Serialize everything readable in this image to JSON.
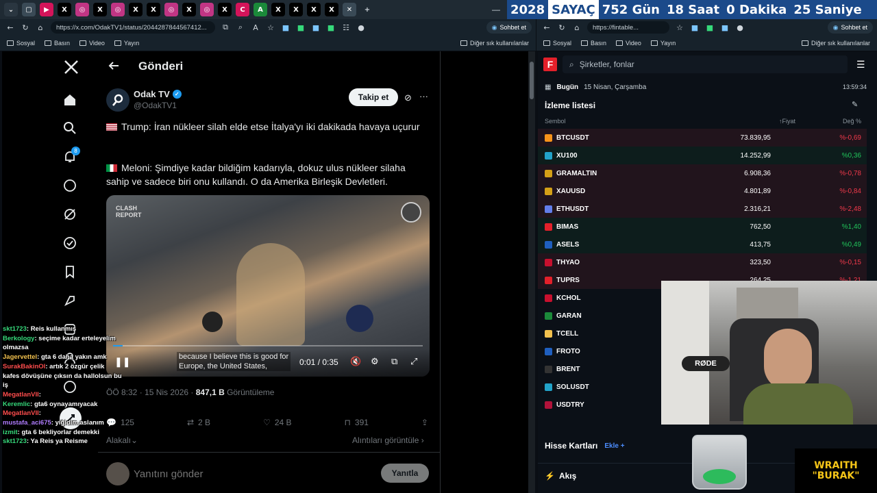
{
  "counter": {
    "year": "2028",
    "label": "SAYAÇ",
    "days": "752 Gün",
    "hours": "18 Saat",
    "minutes": "0 Dakika",
    "seconds": "25 Saniye"
  },
  "left_browser": {
    "url": "https://x.com/OdakTV1/status/2044287844567412...",
    "chat_button": "Sohbet et",
    "bookmarks": [
      "Sosyal",
      "Basın",
      "Video",
      "Yayın"
    ],
    "bookmarks_other": "Diğer sık kullanılanlar"
  },
  "x": {
    "notification_count": "8",
    "header_title": "Gönderi",
    "author_name": "Odak TV",
    "author_handle": "@OdakTV1",
    "follow_button": "Takip et",
    "paragraph1": "Trump:  İran nükleer silah elde etse İtalya'yı iki dakikada havaya uçurur",
    "paragraph2": "Meloni: Şimdiye kadar bildiğim kadarıyla, dokuz ulus nükleer silaha sahip ve sadece biri onu kullandı. O da Amerika Birleşik Devletleri.",
    "video_watermark": "CLASH REPORT",
    "video_caption_line1": "because I believe this is good for",
    "video_caption_line2": "Europe, the United States,",
    "video_time": "0:01 / 0:35",
    "video_progress": 0.03,
    "timestamp": "ÖÖ 8:32 · 15 Nis 2026 · ",
    "views_count": "847,1 B",
    "views_label": " Görüntüleme",
    "replies": "125",
    "reposts": "2 B",
    "likes": "24 B",
    "bookmarks": "391",
    "related": "Alakalı",
    "quotes_link": "Alıntıları görüntüle",
    "reply_placeholder": "Yanıtını gönder",
    "reply_button": "Yanıtla"
  },
  "chat": [
    {
      "user": "skt1723",
      "msg": "Reis kullanmış",
      "color": "#36d97b"
    },
    {
      "user": "Berkology",
      "msg": "seçime kadar erteleyelim olmazsa",
      "color": "#36d97b"
    },
    {
      "user": "Jagervettel",
      "msg": "gta 6 daha yakın amk",
      "color": "#f2c14e"
    },
    {
      "user": "SurakBakinOl",
      "msg": "artık 2 özgür çelik kafes dövüşüne çıksın da hallolsun bu iş",
      "color": "#ff4d4d"
    },
    {
      "user": "MegatlanVII",
      "msg": "",
      "color": "#ff4d4d"
    },
    {
      "user": "Keremlic",
      "msg": "gta6 oynayamıyacak",
      "color": "#36d97b"
    },
    {
      "user": "MegatlanVII",
      "msg": "",
      "color": "#ff4d4d"
    },
    {
      "user": "mustafa_aci675",
      "msg": "yiğidim aslanım",
      "color": "#b07cff"
    },
    {
      "user": "izmit",
      "msg": "gta 6 bekliyorlar demekki",
      "color": "#36d97b"
    },
    {
      "user": "skt1723",
      "msg": "Ya Reis ya Reisme",
      "color": "#36d97b"
    }
  ],
  "right_browser": {
    "url": "https://fintable...",
    "chat_button": "Sohbet et",
    "bookmarks": [
      "Sosyal",
      "Basın",
      "Video",
      "Yayın"
    ],
    "bookmarks_other": "Diğer sık kullanılanlar"
  },
  "fintable": {
    "search_placeholder": "Şirketler, fonlar",
    "today_label": "Bugün",
    "date": "15 Nisan, Çarşamba",
    "time": "13:59:34",
    "watchlist_title": "İzleme listesi",
    "col_symbol": "Sembol",
    "col_price": "↑Fiyat",
    "col_change": "Değ %",
    "rows": [
      {
        "symbol": "BTCUSDT",
        "price": "73.839,95",
        "change": "%-0,69",
        "up": false,
        "icon_color": "#f7931a"
      },
      {
        "symbol": "XU100",
        "price": "14.252,99",
        "change": "%0,36",
        "up": true,
        "icon_color": "#22a3c9"
      },
      {
        "symbol": "GRAMALTIN",
        "price": "6.908,36",
        "change": "%-0,78",
        "up": false,
        "icon_color": "#d4a017"
      },
      {
        "symbol": "XAUUSD",
        "price": "4.801,89",
        "change": "%-0,84",
        "up": false,
        "icon_color": "#d4a017"
      },
      {
        "symbol": "ETHUSDT",
        "price": "2.316,21",
        "change": "%-2,48",
        "up": false,
        "icon_color": "#627eea"
      },
      {
        "symbol": "BIMAS",
        "price": "762,50",
        "change": "%1,40",
        "up": true,
        "icon_color": "#e3202a"
      },
      {
        "symbol": "ASELS",
        "price": "413,75",
        "change": "%0,49",
        "up": true,
        "icon_color": "#1f5fbf"
      },
      {
        "symbol": "THYAO",
        "price": "323,50",
        "change": "%-0,15",
        "up": false,
        "icon_color": "#c8102e"
      },
      {
        "symbol": "TUPRS",
        "price": "264,25",
        "change": "%-1,21",
        "up": false,
        "icon_color": "#e3202a"
      },
      {
        "symbol": "KCHOL",
        "price": "",
        "change": "",
        "up": true,
        "icon_color": "#c8102e"
      },
      {
        "symbol": "GARAN",
        "price": "",
        "change": "",
        "up": true,
        "icon_color": "#1b8a3a"
      },
      {
        "symbol": "TCELL",
        "price": "",
        "change": "",
        "up": true,
        "icon_color": "#f2c14e"
      },
      {
        "symbol": "FROTO",
        "price": "",
        "change": "",
        "up": true,
        "icon_color": "#1f5fbf"
      },
      {
        "symbol": "BRENT",
        "price": "",
        "change": "",
        "up": true,
        "icon_color": "#333333"
      },
      {
        "symbol": "SOLUSDT",
        "price": "",
        "change": "",
        "up": true,
        "icon_color": "#22a3c9"
      },
      {
        "symbol": "USDTRY",
        "price": "",
        "change": "",
        "up": true,
        "icon_color": "#b0123a"
      }
    ],
    "cards_title": "Hisse Kartları",
    "cards_add": "Ekle",
    "flow_title": "Akış"
  },
  "overlay": {
    "mic_brand": "RØDE",
    "logo_line1": "WRAITH",
    "logo_line2": "\"BURAK\""
  },
  "colors": {
    "up": "#21c35a",
    "down": "#f0394a",
    "x_blue": "#1d9bf0"
  }
}
